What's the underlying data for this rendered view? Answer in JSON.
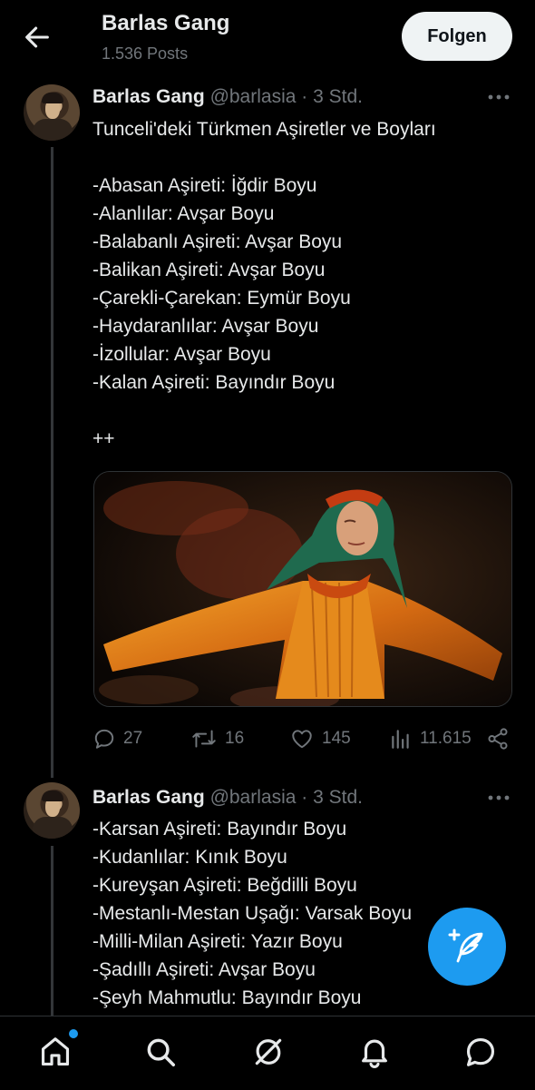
{
  "header": {
    "title": "Barlas Gang",
    "subtitle": "1.536 Posts",
    "follow_label": "Folgen"
  },
  "tweets": [
    {
      "name": "Barlas Gang",
      "meta": "@barlasia · 3 Std.",
      "lines": [
        "Tunceli'deki Türkmen Aşiretler ve Boyları",
        "",
        "-Abasan Aşireti: İğdir Boyu",
        "-Alanlılar: Avşar Boyu",
        "-Balabanlı Aşireti: Avşar Boyu",
        "-Balikan Aşireti: Avşar Boyu",
        "-Çarekli-Çarekan: Eymür Boyu",
        "-Haydaranlılar: Avşar Boyu",
        "-İzollular: Avşar Boyu",
        "-Kalan Aşireti: Bayındır Boyu",
        "",
        "++"
      ],
      "media": {
        "description_icon": "photo-dancer-in-orange-costume"
      },
      "stats": {
        "replies": "27",
        "reposts": "16",
        "likes": "145",
        "views": "11.615"
      }
    },
    {
      "name": "Barlas Gang",
      "meta": "@barlasia · 3 Std.",
      "lines": [
        "-Karsan Aşireti: Bayındır Boyu",
        "-Kudanlılar: Kınık Boyu",
        "-Kureyşan Aşireti: Beğdilli Boyu",
        "-Mestanlı-Mestan Uşağı: Varsak Boyu",
        "-Milli-Milan Aşireti: Yazır Boyu",
        "-Şadıllı Aşireti: Avşar Boyu",
        "-Şeyh Mahmutlu: Bayındır Boyu"
      ]
    }
  ],
  "icons": {
    "back": "arrow-left-icon",
    "more": "more-horizontal-icon",
    "reply": "reply-icon",
    "repost": "repost-icon",
    "like": "heart-icon",
    "views": "views-icon",
    "share": "share-icon",
    "compose": "compose-icon"
  },
  "bottom_nav": [
    "home-icon",
    "search-icon",
    "grok-icon",
    "notifications-icon",
    "messages-icon"
  ],
  "colors": {
    "accent": "#1d9bf0",
    "background": "#000000",
    "text": "#e7e9ea",
    "muted": "#71767b"
  }
}
